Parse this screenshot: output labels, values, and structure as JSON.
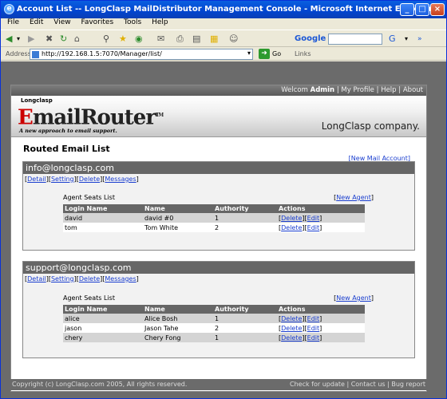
{
  "window": {
    "title": "Account List -- LongClasp MailDistributor Management Console - Microsoft Internet Explorer"
  },
  "menu": [
    "File",
    "Edit",
    "View",
    "Favorites",
    "Tools",
    "Help"
  ],
  "toolbar": {
    "google_label": "Google"
  },
  "address": {
    "label": "Address",
    "url": "http://192.168.1.5:7070/Manager/list/",
    "go": "Go",
    "links": "Links"
  },
  "topnav": {
    "welcome": "Welcom",
    "user": "Admin",
    "profile": "My Profile",
    "help": "Help",
    "about": "About",
    "sep": " | "
  },
  "header": {
    "small_logo": "Longclasp",
    "brand_e": "E",
    "brand_rest": "mailRouter",
    "tm": "TM",
    "tagline": "A new approach to email support.",
    "company": "LongClasp company."
  },
  "page": {
    "title": "Routed Email List",
    "new_mail": "[New Mail Account]"
  },
  "account_actions": [
    "Detail",
    "Setting",
    "Delete",
    "Messages"
  ],
  "seat_list_label": "Agent Seats List",
  "new_agent": "New Agent",
  "columns": [
    "Login Name",
    "Name",
    "Authority",
    "Actions"
  ],
  "row_actions": [
    "Delete",
    "Edit"
  ],
  "accounts": [
    {
      "email": "info@longclasp.com",
      "agents": [
        {
          "login": "david",
          "name": "david #0",
          "authority": "1"
        },
        {
          "login": "tom",
          "name": "Tom White",
          "authority": "2"
        }
      ]
    },
    {
      "email": "support@longclasp.com",
      "agents": [
        {
          "login": "alice",
          "name": "Alice Bosh",
          "authority": "1"
        },
        {
          "login": "jason",
          "name": "Jason Tahe",
          "authority": "2"
        },
        {
          "login": "chery",
          "name": "Chery Fong",
          "authority": "1"
        }
      ]
    }
  ],
  "footer": {
    "copyright": "Copyright (c) LongClasp.com 2005, All rights reserved.",
    "links": [
      "Check for update",
      "Contact us",
      "Bug report"
    ]
  }
}
